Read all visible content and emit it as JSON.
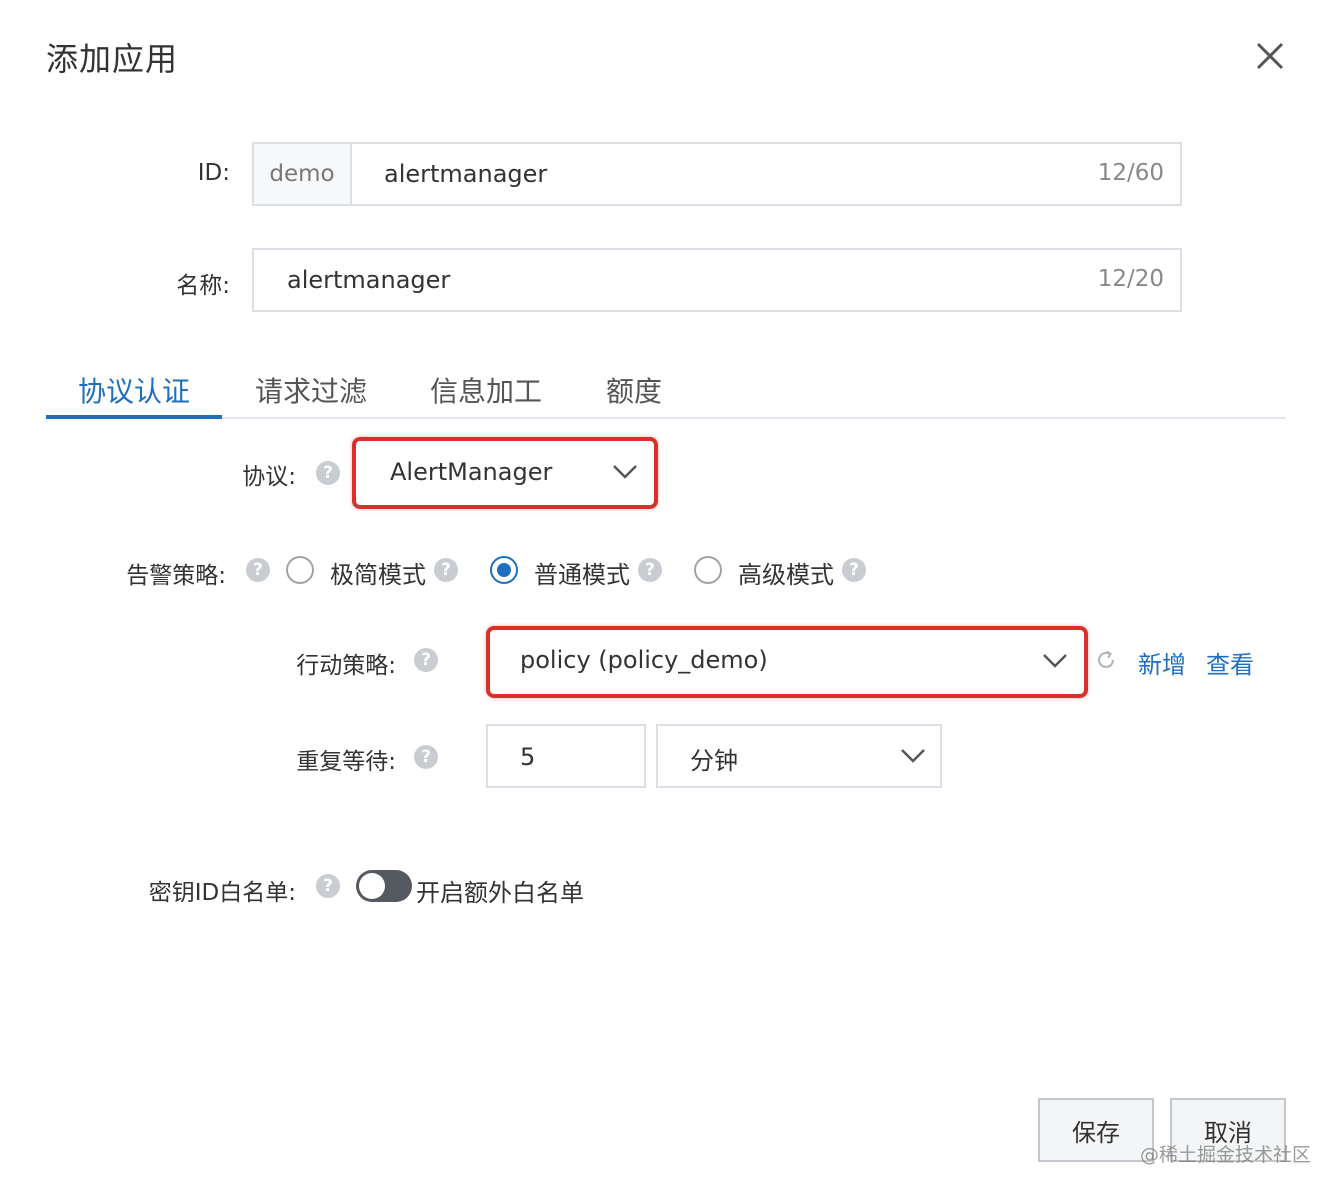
{
  "dialog": {
    "title": "添加应用"
  },
  "form": {
    "id": {
      "label": "ID:",
      "prefix": "demo",
      "value": "alertmanager",
      "counter": "12/60"
    },
    "name": {
      "label": "名称:",
      "value": "alertmanager",
      "counter": "12/20"
    }
  },
  "tabs": [
    {
      "label": "协议认证",
      "active": true
    },
    {
      "label": "请求过滤",
      "active": false
    },
    {
      "label": "信息加工",
      "active": false
    },
    {
      "label": "额度",
      "active": false
    }
  ],
  "protocol": {
    "label": "协议:",
    "value": "AlertManager"
  },
  "alert_policy": {
    "label": "告警策略:",
    "options": [
      {
        "label": "极简模式",
        "checked": false
      },
      {
        "label": "普通模式",
        "checked": true
      },
      {
        "label": "高级模式",
        "checked": false
      }
    ]
  },
  "action_policy": {
    "label": "行动策略:",
    "value": "policy (policy_demo)",
    "add_link": "新增",
    "view_link": "查看"
  },
  "repeat_wait": {
    "label": "重复等待:",
    "value": "5",
    "unit": "分钟"
  },
  "key_whitelist": {
    "label": "密钥ID白名单:",
    "toggle_label": "开启额外白名单",
    "enabled": false
  },
  "buttons": {
    "save": "保存",
    "cancel": "取消"
  },
  "watermark": "@稀土掘金技术社区",
  "help_glyph": "?",
  "colors": {
    "accent": "#1f6fbf",
    "highlight": "#d9302a"
  }
}
